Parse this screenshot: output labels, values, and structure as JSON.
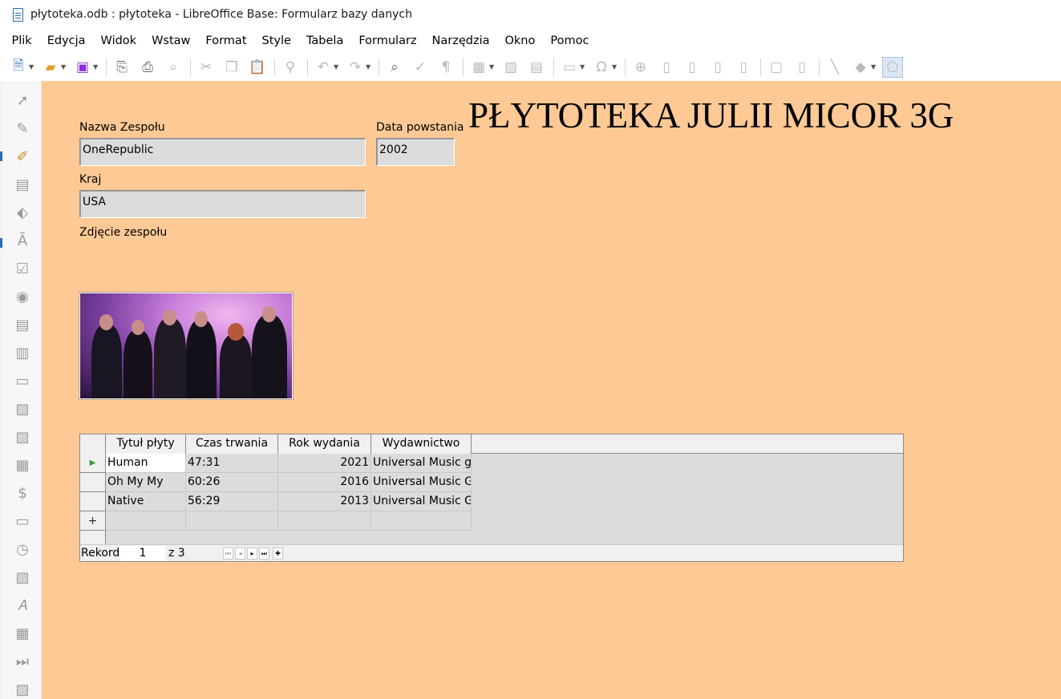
{
  "window": {
    "title": "płytoteka.odb : płytoteka - LibreOffice Base: Formularz bazy danych"
  },
  "menu": [
    "Plik",
    "Edycja",
    "Widok",
    "Wstaw",
    "Format",
    "Style",
    "Tabela",
    "Formularz",
    "Narzędzia",
    "Okno",
    "Pomoc"
  ],
  "form": {
    "title": "PŁYTOTEKA JULII MICOR 3G",
    "band_name_label": "Nazwa Zespołu",
    "band_name_value": "OneRepublic",
    "founded_label": "Data powstania",
    "founded_value": "2002",
    "country_label": "Kraj",
    "country_value": "USA",
    "photo_label": "Zdjęcie zespołu"
  },
  "table": {
    "columns": [
      "Tytuł płyty",
      "Czas trwania",
      "Rok wydania",
      "Wydawnictwo"
    ],
    "rows": [
      [
        "Human",
        "47:31",
        "2021",
        "Universal Music gr"
      ],
      [
        "Oh My My",
        "60:26",
        "2016",
        "Universal Music Gr"
      ],
      [
        "Native",
        "56:29",
        "2013",
        "Universal Music Gr"
      ]
    ],
    "new_row_marker": "+",
    "current_row_marker": "▶"
  },
  "navigation": {
    "record_label": "Rekord",
    "record_value": "1",
    "of_label": "z 3"
  },
  "colors": {
    "canvas": "#fec995",
    "field": "#dcdcdc"
  }
}
